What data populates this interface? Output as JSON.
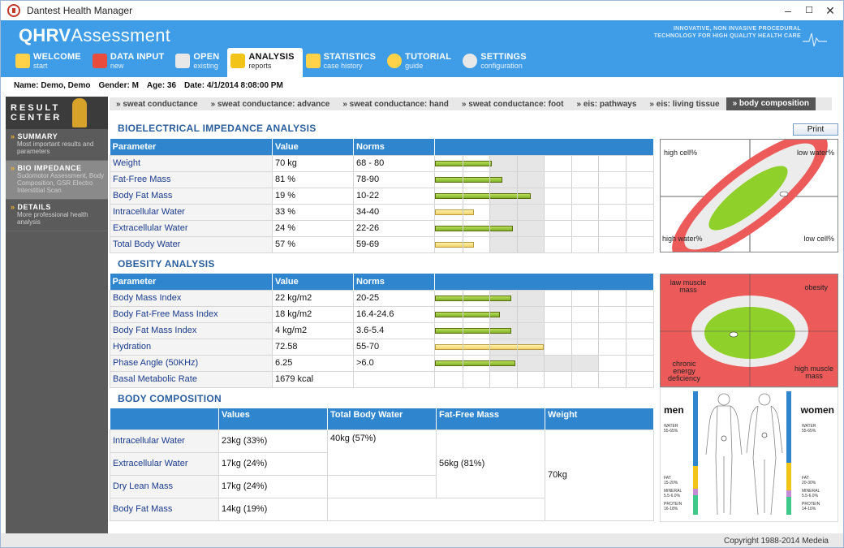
{
  "window": {
    "title": "Dantest Health Manager",
    "controls": [
      "–",
      "☐",
      "✕"
    ]
  },
  "header": {
    "logo_bold": "QHRV",
    "logo_rest": "Assessment",
    "tagline_1": "INNOVATIVE, NON INVASIVE PROCEDURAL",
    "tagline_2": "TECHNOLOGY FOR HIGH QUALITY HEALTH CARE"
  },
  "tabs": [
    {
      "label": "WELCOME",
      "sub": "start",
      "icon": "home-icon"
    },
    {
      "label": "DATA INPUT",
      "sub": "new",
      "icon": "heart-icon"
    },
    {
      "label": "OPEN",
      "sub": "existing",
      "icon": "printer-icon"
    },
    {
      "label": "ANALYSIS",
      "sub": "reports",
      "icon": "report-icon"
    },
    {
      "label": "STATISTICS",
      "sub": "case history",
      "icon": "bar-chart-icon"
    },
    {
      "label": "TUTORIAL",
      "sub": "guide",
      "icon": "lightbulb-icon"
    },
    {
      "label": "SETTINGS",
      "sub": "configuration",
      "icon": "gear-icon"
    }
  ],
  "patient": {
    "name": "Name: Demo, Demo",
    "gender": "Gender: M",
    "age": "Age: 36",
    "date": "Date: 4/1/2014 8:08:00 PM"
  },
  "sidebar": {
    "banner_1": "RESULT",
    "banner_2": "CENTER",
    "items": [
      {
        "title": "SUMMARY",
        "desc": "Most important results and parameters"
      },
      {
        "title": "BIO IMPEDANCE",
        "desc": "Sudomotor Assessment, Body Composition, GSR Electro Interstitial Scan"
      },
      {
        "title": "DETAILS",
        "desc": "More professional health analysis"
      }
    ]
  },
  "subtabs": [
    "» sweat conductance",
    "» sweat conductance: advance",
    "» sweat conductance: hand",
    "» sweat conductance: foot",
    "» eis: pathways",
    "» eis: living tissue",
    "» body composition"
  ],
  "print_label": "Print",
  "bia": {
    "title": "BIOELECTRICAL IMPEDANCE ANALYSIS",
    "headers": [
      "Parameter",
      "Value",
      "Norms"
    ],
    "rows": [
      {
        "param": "Weight",
        "value": "70 kg",
        "norm": "68 - 80",
        "level": 0.26,
        "color": "green"
      },
      {
        "param": "Fat-Free Mass",
        "value": "81 %",
        "norm": "78-90",
        "level": 0.31,
        "color": "green"
      },
      {
        "param": "Body Fat Mass",
        "value": "19 %",
        "norm": "10-22",
        "level": 0.44,
        "color": "green"
      },
      {
        "param": "Intracellular Water",
        "value": "33 %",
        "norm": "34-40",
        "level": 0.18,
        "color": "yellow"
      },
      {
        "param": "Extracellular Water",
        "value": "24 %",
        "norm": "22-26",
        "level": 0.36,
        "color": "green"
      },
      {
        "param": "Total Body Water",
        "value": "57 %",
        "norm": "59-69",
        "level": 0.18,
        "color": "yellow"
      }
    ],
    "quadrant": {
      "top_left": "high cell%",
      "top_right": "low water%",
      "bottom_left": "high water%",
      "bottom_right": "low cell%"
    }
  },
  "obesity": {
    "title": "OBESITY ANALYSIS",
    "headers": [
      "Parameter",
      "Value",
      "Norms"
    ],
    "rows": [
      {
        "param": "Body Mass Index",
        "value": "22 kg/m2",
        "norm": "20-25",
        "level": 0.35,
        "color": "green"
      },
      {
        "param": "Body Fat-Free Mass Index",
        "value": "18 kg/m2",
        "norm": "16.4-24.6",
        "level": 0.3,
        "color": "green"
      },
      {
        "param": "Body Fat Mass Index",
        "value": "4 kg/m2",
        "norm": "3.6-5.4",
        "level": 0.35,
        "color": "green"
      },
      {
        "param": "Hydration",
        "value": "72.58",
        "norm": "55-70",
        "level": 0.5,
        "color": "yellow"
      },
      {
        "param": "Phase Angle (50KHz)",
        "value": "6.25",
        "norm": ">6.0",
        "level": 0.37,
        "color": "green"
      },
      {
        "param": "Basal Metabolic Rate",
        "value": "1679 kcal",
        "norm": "",
        "level": 0,
        "color": "none"
      }
    ],
    "quadrant": {
      "top_left": "law muscle mass",
      "top_right": "obesity",
      "bottom_left": "chronic energy deficiency",
      "bottom_right": "high muscle mass"
    }
  },
  "composition": {
    "title": "BODY COMPOSITION",
    "headers": [
      "",
      "Values",
      "Total Body Water",
      "Fat-Free Mass",
      "Weight"
    ],
    "rows": [
      {
        "param": "Intracellular Water",
        "value": "23kg (33%)"
      },
      {
        "param": "Extracellular Water",
        "value": "17kg (24%)"
      },
      {
        "param": "Dry Lean Mass",
        "value": "17kg (24%)"
      },
      {
        "param": "Body Fat Mass",
        "value": "14kg (19%)"
      }
    ],
    "total_body_water": "40kg (57%)",
    "fat_free_mass": "56kg (81%)",
    "weight": "70kg"
  },
  "bodyfig": {
    "men": "men",
    "women": "women",
    "scale_labels": [
      "WATER",
      "55-65%",
      "FAT",
      "15-20%",
      "MINERAL",
      "5.5-6.0%",
      "PROTEIN",
      "16-18%"
    ],
    "women_scale": [
      "WATER",
      "55-65%",
      "FAT",
      "20-30%",
      "MINERAL",
      "5.5-6.0%",
      "PROTEIN",
      "14-16%"
    ]
  },
  "footer": "Copyright 1988-2014 Medeia",
  "colors": {
    "header": "#3f9ce7",
    "table_header": "#2f86cf",
    "bar_green": "#8cc63f",
    "bar_yellow": "#f6dd80",
    "danger": "#ec5a5a",
    "safe": "#8fd12a"
  }
}
